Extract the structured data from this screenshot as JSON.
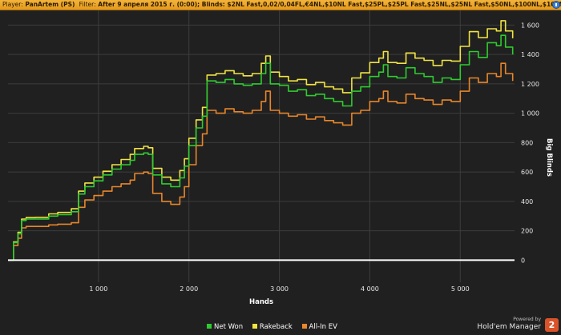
{
  "header": {
    "player_label": "Player:",
    "player": "PanArtem (PS)",
    "filter_label": "Filter:",
    "filter": "After 9 апреля 2015 г. (0:00); Blinds: $2NL Fast,0,02/0,04FL,€4NL,$10NL Fast,$25PL,$25PL Fast,$25NL,$25NL Fast,$50NL,$100NL,$100NL CAP,$100NL Fast,$200PL,$200NL"
  },
  "brand": {
    "powered": "Powered by",
    "name": "Hold'em Manager",
    "logo": "2"
  },
  "colors": {
    "net_won": "#2ecc2e",
    "rakeback": "#f0e442",
    "all_in_ev": "#e8862a",
    "zero_line": "#ffffff",
    "grid": "#3c3c3c"
  },
  "chart_data": {
    "type": "line",
    "xlabel": "Hands",
    "ylabel": "Big Blinds",
    "xlim": [
      0,
      5600
    ],
    "ylim": [
      -150,
      1700
    ],
    "xticks": [
      1000,
      2000,
      3000,
      4000,
      5000
    ],
    "xtick_labels": [
      "1 000",
      "2 000",
      "3 000",
      "4 000",
      "5 000"
    ],
    "yticks": [
      0,
      200,
      400,
      600,
      800,
      1000,
      1200,
      1400,
      1600
    ],
    "ytick_labels": [
      "0",
      "200",
      "400",
      "600",
      "800",
      "1 000",
      "1 200",
      "1 400",
      "1 600"
    ],
    "grid": true,
    "legend_position": "bottom",
    "series": [
      {
        "name": "Net Won",
        "color": "#2ecc2e",
        "x": [
          0,
          60,
          110,
          150,
          200,
          300,
          450,
          550,
          700,
          780,
          850,
          950,
          1050,
          1150,
          1250,
          1350,
          1400,
          1500,
          1550,
          1600,
          1700,
          1800,
          1900,
          1950,
          2000,
          2080,
          2150,
          2200,
          2300,
          2400,
          2500,
          2600,
          2700,
          2800,
          2850,
          2900,
          3000,
          3100,
          3200,
          3300,
          3400,
          3500,
          3600,
          3700,
          3800,
          3900,
          4000,
          4100,
          4150,
          4200,
          4300,
          4400,
          4500,
          4600,
          4700,
          4800,
          4900,
          5000,
          5100,
          5200,
          5300,
          5400,
          5450,
          5500,
          5580
        ],
        "y": [
          0,
          120,
          180,
          270,
          280,
          280,
          300,
          310,
          330,
          450,
          500,
          540,
          580,
          620,
          650,
          680,
          720,
          730,
          720,
          580,
          520,
          500,
          560,
          640,
          780,
          900,
          980,
          1220,
          1210,
          1230,
          1200,
          1190,
          1200,
          1270,
          1340,
          1200,
          1190,
          1150,
          1160,
          1120,
          1130,
          1100,
          1080,
          1050,
          1150,
          1180,
          1250,
          1280,
          1330,
          1250,
          1240,
          1310,
          1270,
          1250,
          1210,
          1240,
          1230,
          1330,
          1420,
          1380,
          1480,
          1460,
          1530,
          1450,
          1400
        ]
      },
      {
        "name": "Rakeback",
        "color": "#f0e442",
        "x": [
          0,
          60,
          110,
          150,
          200,
          300,
          450,
          550,
          700,
          780,
          850,
          950,
          1050,
          1150,
          1250,
          1350,
          1400,
          1500,
          1550,
          1600,
          1700,
          1800,
          1900,
          1950,
          2000,
          2080,
          2150,
          2200,
          2300,
          2400,
          2500,
          2600,
          2700,
          2800,
          2850,
          2900,
          3000,
          3100,
          3200,
          3300,
          3400,
          3500,
          3600,
          3700,
          3800,
          3900,
          4000,
          4100,
          4150,
          4200,
          4300,
          4400,
          4500,
          4600,
          4700,
          4800,
          4900,
          5000,
          5100,
          5200,
          5300,
          5400,
          5450,
          5500,
          5580
        ],
        "y": [
          0,
          125,
          190,
          280,
          290,
          292,
          315,
          325,
          350,
          470,
          525,
          565,
          605,
          650,
          685,
          720,
          760,
          775,
          765,
          625,
          565,
          545,
          610,
          690,
          830,
          955,
          1040,
          1260,
          1270,
          1290,
          1270,
          1255,
          1270,
          1340,
          1390,
          1280,
          1250,
          1220,
          1230,
          1195,
          1210,
          1180,
          1165,
          1140,
          1240,
          1275,
          1345,
          1375,
          1420,
          1345,
          1340,
          1410,
          1375,
          1360,
          1325,
          1360,
          1355,
          1455,
          1555,
          1515,
          1575,
          1560,
          1630,
          1560,
          1510
        ]
      },
      {
        "name": "All-In EV",
        "color": "#e8862a",
        "x": [
          0,
          60,
          110,
          150,
          200,
          300,
          450,
          550,
          700,
          780,
          850,
          950,
          1050,
          1150,
          1250,
          1350,
          1400,
          1500,
          1550,
          1600,
          1700,
          1800,
          1900,
          1950,
          2000,
          2080,
          2150,
          2200,
          2300,
          2400,
          2500,
          2600,
          2700,
          2800,
          2850,
          2900,
          3000,
          3100,
          3200,
          3300,
          3400,
          3500,
          3600,
          3700,
          3800,
          3900,
          4000,
          4100,
          4150,
          4200,
          4300,
          4400,
          4500,
          4600,
          4700,
          4800,
          4900,
          5000,
          5100,
          5200,
          5300,
          5400,
          5450,
          5500,
          5580
        ],
        "y": [
          0,
          100,
          150,
          220,
          230,
          230,
          240,
          245,
          255,
          360,
          410,
          440,
          470,
          500,
          520,
          545,
          590,
          600,
          590,
          455,
          400,
          380,
          430,
          500,
          650,
          780,
          860,
          1020,
          1000,
          1030,
          1010,
          1000,
          1020,
          1080,
          1150,
          1020,
          1000,
          980,
          990,
          960,
          975,
          950,
          935,
          920,
          1000,
          1020,
          1080,
          1100,
          1150,
          1080,
          1070,
          1130,
          1100,
          1090,
          1060,
          1090,
          1080,
          1150,
          1240,
          1210,
          1270,
          1250,
          1340,
          1270,
          1220
        ]
      }
    ]
  }
}
